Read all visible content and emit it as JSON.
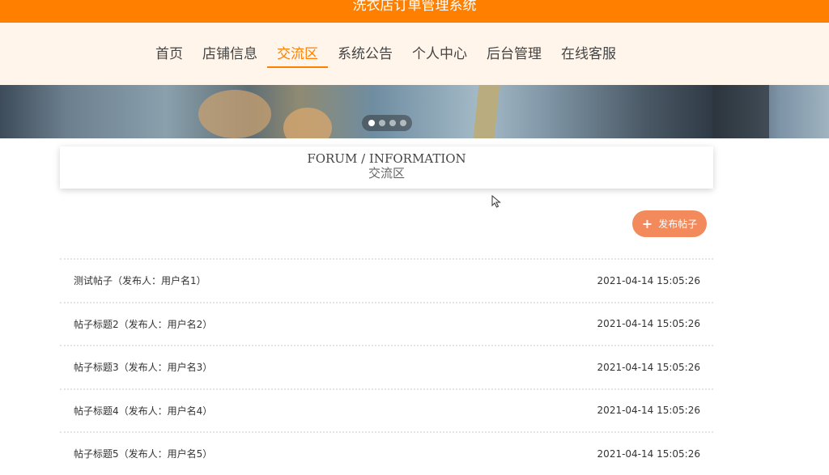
{
  "header": {
    "title": "洗衣店订单管理系统"
  },
  "nav": {
    "items": [
      {
        "label": "首页"
      },
      {
        "label": "店铺信息"
      },
      {
        "label": "交流区",
        "active": true
      },
      {
        "label": "系统公告"
      },
      {
        "label": "个人中心"
      },
      {
        "label": "后台管理"
      },
      {
        "label": "在线客服"
      }
    ]
  },
  "banner": {
    "slides": 4,
    "active_slide": 1
  },
  "section": {
    "title_en": "FORUM / INFORMATION",
    "title_zh": "交流区"
  },
  "actions": {
    "publish_label": "发布帖子",
    "publish_icon": "plus-icon"
  },
  "posts": [
    {
      "title": "测试帖子（发布人：用户名1）",
      "time": "2021-04-14 15:05:26"
    },
    {
      "title": "帖子标题2（发布人：用户名2）",
      "time": "2021-04-14 15:05:26"
    },
    {
      "title": "帖子标题3（发布人：用户名3）",
      "time": "2021-04-14 15:05:26"
    },
    {
      "title": "帖子标题4（发布人：用户名4）",
      "time": "2021-04-14 15:05:26"
    },
    {
      "title": "帖子标题5（发布人：用户名5）",
      "time": "2021-04-14 15:05:26"
    }
  ],
  "colors": {
    "accent": "#ff7f00",
    "nav_bg": "#fff5ea",
    "button": "#f28a5c"
  }
}
